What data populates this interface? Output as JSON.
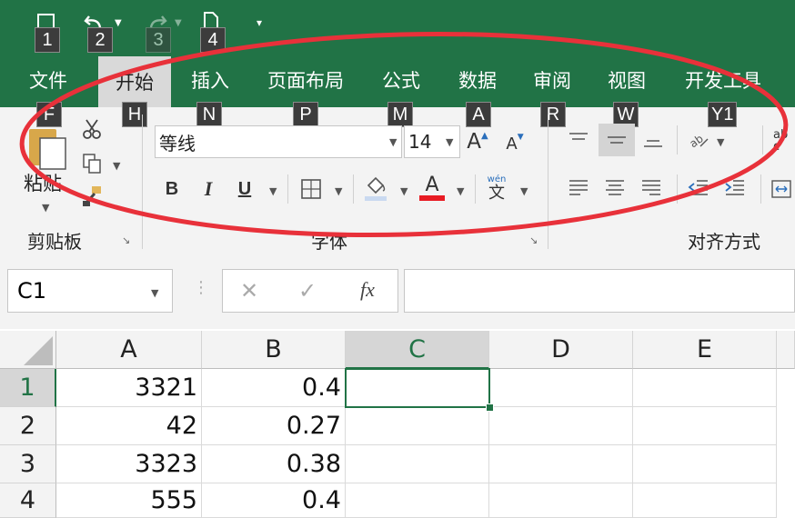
{
  "quick_access": {
    "keytips": [
      "1",
      "2",
      "3",
      "4"
    ]
  },
  "tabs": [
    {
      "label": "文件",
      "keytip": "F"
    },
    {
      "label": "开始",
      "keytip": "H",
      "active": true
    },
    {
      "label": "插入",
      "keytip": "N"
    },
    {
      "label": "页面布局",
      "keytip": "P"
    },
    {
      "label": "公式",
      "keytip": "M"
    },
    {
      "label": "数据",
      "keytip": "A"
    },
    {
      "label": "审阅",
      "keytip": "R"
    },
    {
      "label": "视图",
      "keytip": "W"
    },
    {
      "label": "开发工具",
      "keytip": "Y1"
    }
  ],
  "ribbon": {
    "clipboard": {
      "paste_label": "粘贴",
      "group_label": "剪贴板"
    },
    "font": {
      "font_name": "等线",
      "font_size": "14",
      "bold": "B",
      "italic": "I",
      "underline": "U",
      "font_color_glyph": "A",
      "phonetic_top": "wén",
      "phonetic_bottom": "文",
      "grow_font": "A",
      "shrink_font": "A",
      "group_label": "字体"
    },
    "alignment": {
      "group_label": "对齐方式",
      "wrap_partial": "ab c"
    }
  },
  "formula_bar": {
    "name_box": "C1",
    "fx": "fx"
  },
  "sheet": {
    "columns": [
      "A",
      "B",
      "C",
      "D",
      "E"
    ],
    "selected_column": "C",
    "rows": [
      {
        "num": "1",
        "a": "3321",
        "b": "0.4"
      },
      {
        "num": "2",
        "a": "42",
        "b": "0.27"
      },
      {
        "num": "3",
        "a": "3323",
        "b": "0.38"
      },
      {
        "num": "4",
        "a": "555",
        "b": "0.4"
      }
    ]
  },
  "colors": {
    "brand_green": "#217346",
    "annotation_red": "#e8313a"
  }
}
